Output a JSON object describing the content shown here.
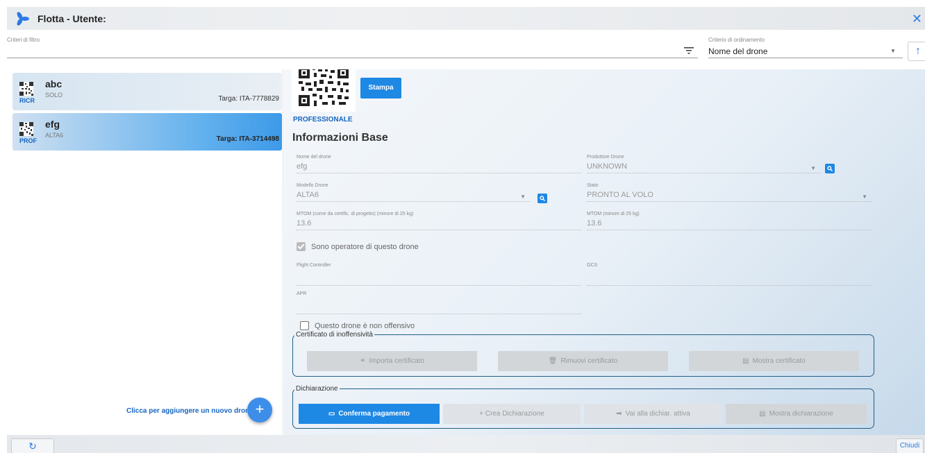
{
  "window": {
    "title": "Flotta - Utente:",
    "logo_icon": "propeller-icon",
    "close_icon": "close-icon",
    "accent": "#2c7be5"
  },
  "filter": {
    "label": "Criteri di filtro",
    "value": "",
    "filter_icon": "filter-icon"
  },
  "sort": {
    "label": "Criterio di ordinamento",
    "value": "Nome del drone",
    "direction_icon": "arrow-up-icon"
  },
  "drones": [
    {
      "name": "abc",
      "model": "SOLO",
      "category": "RICR",
      "plate": "Targa: ITA-7778829",
      "selected": false
    },
    {
      "name": "efg",
      "model": "ALTA6",
      "category": "PROF",
      "plate": "Targa: ITA-3714498",
      "selected": true
    }
  ],
  "add_drone": {
    "hint": "Clicca per aggiungere un nuovo drone.",
    "button_label": "+"
  },
  "detail": {
    "print_button": "Stampa",
    "category_label": "PROFESSIONALE",
    "section_title": "Informazioni Base",
    "fields": {
      "nome": {
        "label": "Nome del drone",
        "value": "efg"
      },
      "produttore": {
        "label": "Produttore Drone",
        "value": "UNKNOWN"
      },
      "modello": {
        "label": "Modello Drone",
        "value": "ALTA6"
      },
      "stato": {
        "label": "Stato",
        "value": "PRONTO AL VOLO"
      },
      "mtom_cert": {
        "label": "MTOM (come da certific. di progetto) (minore di 25 kg)",
        "value": "13.6"
      },
      "mtom": {
        "label": "MTOM (minore di 25 kg)",
        "value": "13.6"
      },
      "flight_controller": {
        "label": "Flight Controller",
        "value": ""
      },
      "gcs": {
        "label": "GCS",
        "value": ""
      },
      "apr": {
        "label": "APR",
        "value": ""
      }
    },
    "operator_checkbox": {
      "label": "Sono operatore di questo drone",
      "checked": true
    },
    "non_offensive_checkbox": {
      "label": "Questo drone è non offensivo",
      "checked": false
    },
    "certificate_group": {
      "legend": "Certificato di inoffensività",
      "import": "Importa certificato",
      "remove": "Rimuovi certificato",
      "show": "Mostra certificato"
    },
    "declaration_group": {
      "legend": "Dichiarazione",
      "confirm_payment": "Conferma pagamento",
      "create": "+ Crea Dichiarazione",
      "go_active": "Vai alla dichiar. attiva",
      "show": "Mostra dichiarazione"
    }
  },
  "footer": {
    "refresh_icon": "refresh-icon",
    "close_label": "Chiudi"
  }
}
